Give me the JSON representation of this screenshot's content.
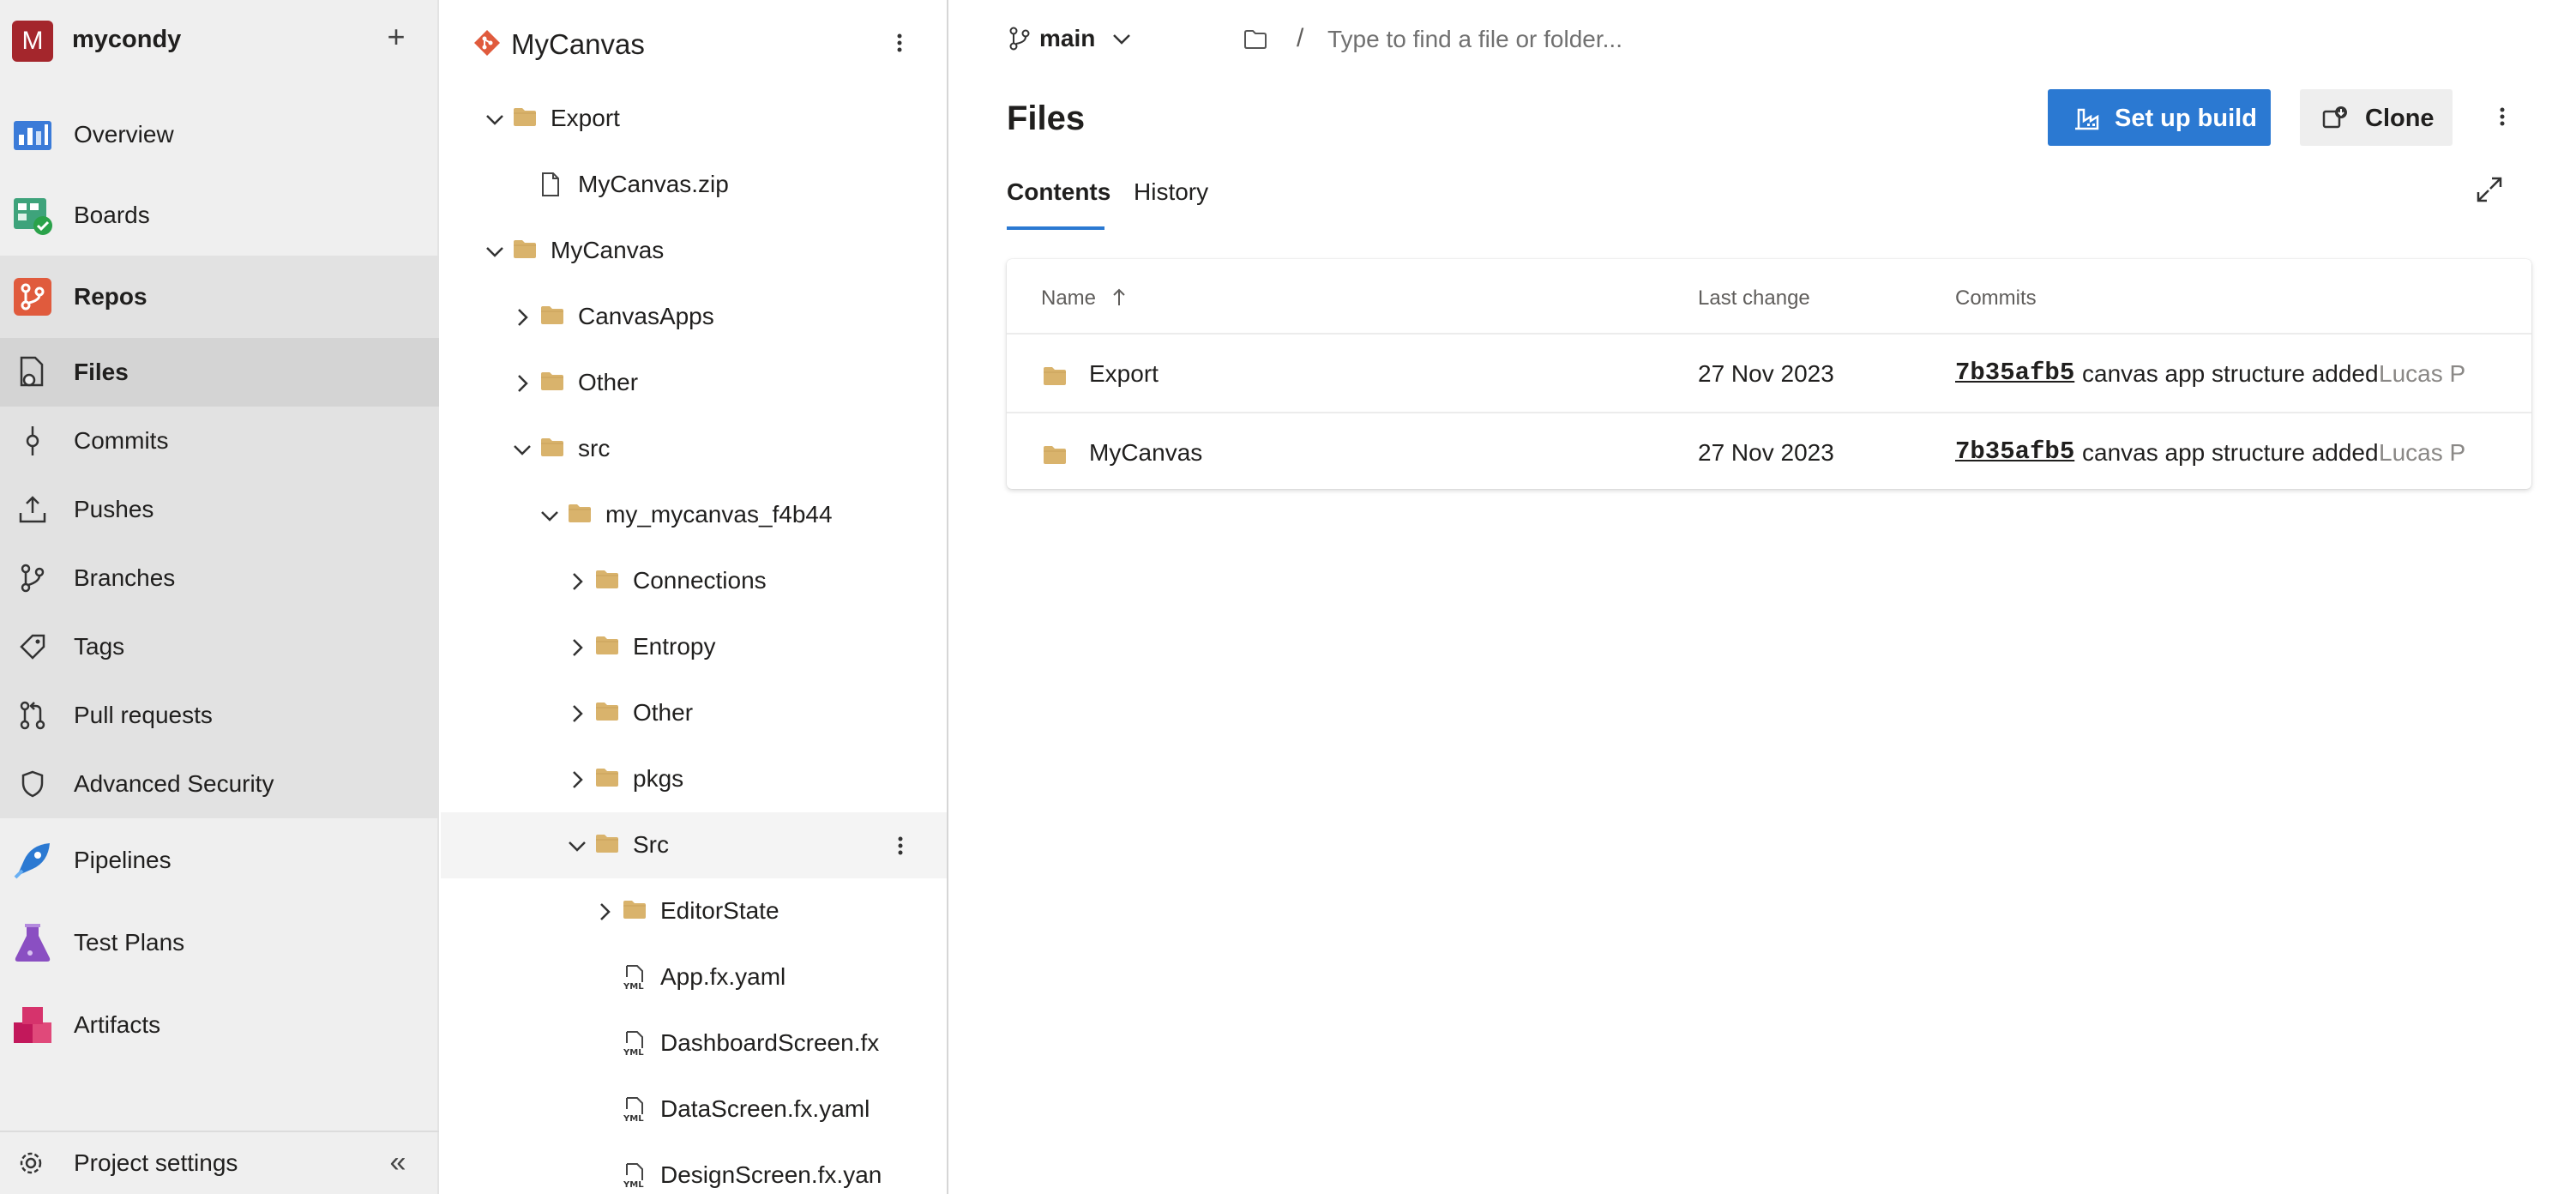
{
  "org": {
    "avatar_letter": "M",
    "name": "mycondy"
  },
  "nav": {
    "overview": "Overview",
    "boards": "Boards",
    "repos": "Repos",
    "files": "Files",
    "commits": "Commits",
    "pushes": "Pushes",
    "branches": "Branches",
    "tags": "Tags",
    "pull_requests": "Pull requests",
    "advanced_security": "Advanced Security",
    "pipelines": "Pipelines",
    "test_plans": "Test Plans",
    "artifacts": "Artifacts",
    "project_settings": "Project settings"
  },
  "repo": {
    "name": "MyCanvas"
  },
  "tree": [
    {
      "name": "Export",
      "type": "folder",
      "expanded": true
    },
    {
      "name": "MyCanvas.zip",
      "type": "file"
    },
    {
      "name": "MyCanvas",
      "type": "folder",
      "expanded": true
    },
    {
      "name": "CanvasApps",
      "type": "folder",
      "expanded": false
    },
    {
      "name": "Other",
      "type": "folder",
      "expanded": false
    },
    {
      "name": "src",
      "type": "folder",
      "expanded": true
    },
    {
      "name": "my_mycanvas_f4b44",
      "type": "folder",
      "expanded": true
    },
    {
      "name": "Connections",
      "type": "folder",
      "expanded": false
    },
    {
      "name": "Entropy",
      "type": "folder",
      "expanded": false
    },
    {
      "name": "Other",
      "type": "folder",
      "expanded": false
    },
    {
      "name": "pkgs",
      "type": "folder",
      "expanded": false
    },
    {
      "name": "Src",
      "type": "folder",
      "expanded": true
    },
    {
      "name": "EditorState",
      "type": "folder",
      "expanded": false
    },
    {
      "name": "App.fx.yaml",
      "type": "yaml"
    },
    {
      "name": "DashboardScreen.fx",
      "type": "yaml"
    },
    {
      "name": "DataScreen.fx.yaml",
      "type": "yaml"
    },
    {
      "name": "DesignScreen.fx.yan",
      "type": "yaml"
    }
  ],
  "header": {
    "branch": "main",
    "path_separator": "/",
    "path_placeholder": "Type to find a file or folder..."
  },
  "page": {
    "title": "Files",
    "setup_build_label": "Set up build",
    "clone_label": "Clone",
    "tabs": [
      {
        "label": "Contents"
      },
      {
        "label": "History"
      }
    ]
  },
  "table": {
    "columns": {
      "name": "Name",
      "last_change": "Last change",
      "commits": "Commits"
    },
    "rows": [
      {
        "name": "Export",
        "last_change": "27 Nov 2023",
        "commit_hash": "7b35afb5",
        "commit_message": "canvas app structure added",
        "author": "Lucas P"
      },
      {
        "name": "MyCanvas",
        "last_change": "27 Nov 2023",
        "commit_hash": "7b35afb5",
        "commit_message": "canvas app structure added",
        "author": "Lucas P"
      }
    ]
  },
  "colors": {
    "accent": "#2b79d2",
    "org_avatar": "#a4262c",
    "folder": "#d9b36c"
  }
}
